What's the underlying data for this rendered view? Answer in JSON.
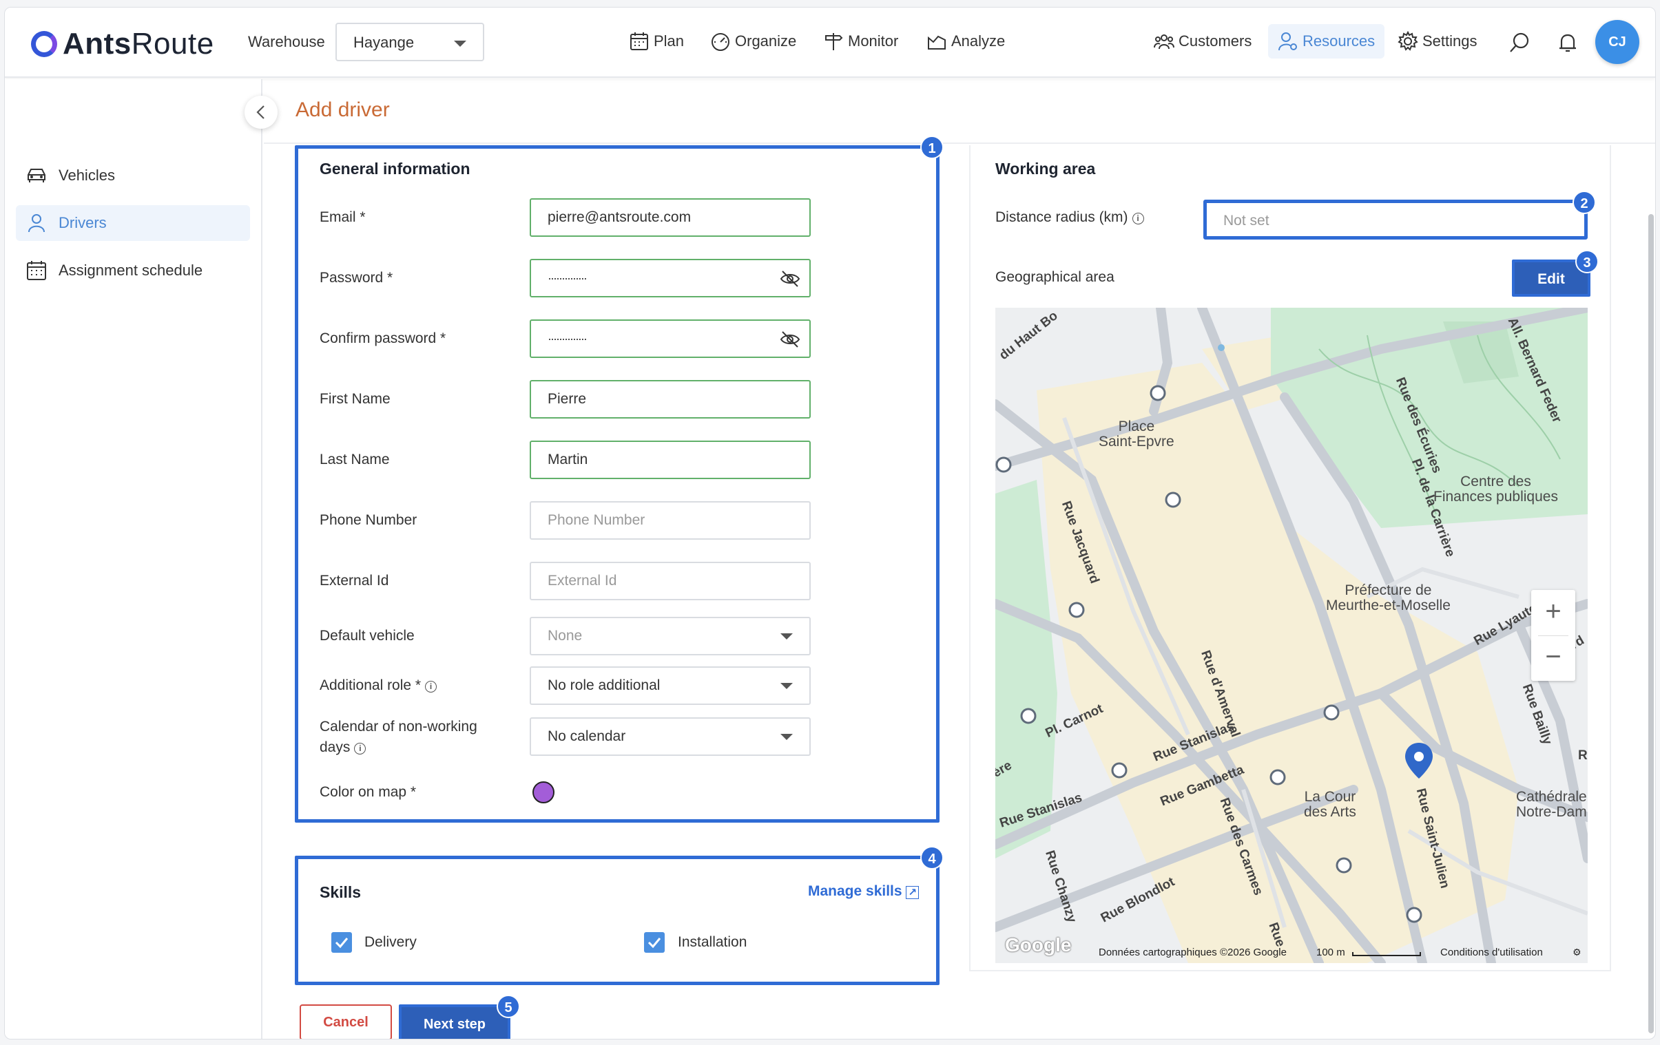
{
  "app": {
    "brand_bold": "Ants",
    "brand_rest": "Route",
    "warehouse_label": "Warehouse",
    "warehouse_value": "Hayange",
    "user_initials": "CJ"
  },
  "nav": {
    "plan": "Plan",
    "organize": "Organize",
    "monitor": "Monitor",
    "analyze": "Analyze",
    "customers": "Customers",
    "resources": "Resources",
    "settings": "Settings"
  },
  "sidebar": {
    "items": [
      {
        "label": "Vehicles"
      },
      {
        "label": "Drivers"
      },
      {
        "label": "Assignment schedule"
      }
    ]
  },
  "page": {
    "title": "Add driver"
  },
  "general": {
    "title": "General information",
    "email_label": "Email *",
    "email_value": "pierre@antsroute.com",
    "password_label": "Password *",
    "password_value": "··············",
    "confirm_label": "Confirm password *",
    "confirm_value": "··············",
    "first_label": "First Name",
    "first_value": "Pierre",
    "last_label": "Last Name",
    "last_value": "Martin",
    "phone_label": "Phone Number",
    "phone_placeholder": "Phone Number",
    "external_label": "External Id",
    "external_placeholder": "External Id",
    "vehicle_label": "Default vehicle",
    "vehicle_value": "None",
    "role_label": "Additional role *",
    "role_value": "No role additional",
    "calendar_label_1": "Calendar of non-working",
    "calendar_label_2": "days",
    "calendar_value": "No calendar",
    "color_label": "Color on map *",
    "color_value": "#a35dd8"
  },
  "skills": {
    "title": "Skills",
    "manage": "Manage skills",
    "items": [
      {
        "label": "Delivery",
        "checked": true
      },
      {
        "label": "Installation",
        "checked": true
      }
    ]
  },
  "working": {
    "title": "Working area",
    "radius_label": "Distance radius (km)",
    "radius_placeholder": "Not set",
    "geo_label": "Geographical area",
    "edit": "Edit"
  },
  "map": {
    "places": {
      "place_st_epvre": [
        "Place",
        "Saint-Epvre"
      ],
      "centre_finances": [
        "Centre des",
        "Finances publiques"
      ],
      "prefecture": [
        "Préfecture de",
        "Meurthe-et-Moselle"
      ],
      "la_cour": [
        "La Cour",
        "des Arts"
      ],
      "cathedrale": [
        "Cathédrale",
        "Notre-Dam"
      ]
    },
    "streets": {
      "haut_bo": "du Haut Bo",
      "bernard": "All. Bernard Feder",
      "ecuries": "Rue des Écuries",
      "carriere": "Pl. de la Carrière",
      "jacquard": "Rue Jacquard",
      "amerval": "Rue d'Amerval",
      "lyautey": "Rue Lyaute",
      "carnot": "Pl. Carnot",
      "stanislas1": "Rue Stanislas",
      "gambetta": "Rue Gambetta",
      "stanislas2": "Rue Stanislas",
      "carmes": "Rue des Carmes",
      "bailly": "Rue Bailly",
      "st_julien": "Rue Saint-Julien",
      "chanzy": "Rue Chanzy",
      "blondlot": "Rue Blondlot",
      "rue_short": "Rue",
      "ere": "ère",
      "rd": "rd",
      "r": "R"
    },
    "footer": {
      "google": "Google",
      "data": "Données cartographiques ©2026 Google",
      "scale": "100 m",
      "terms": "Conditions d'utilisation"
    }
  },
  "actions": {
    "cancel": "Cancel",
    "next": "Next step"
  },
  "badges": [
    "1",
    "2",
    "3",
    "4",
    "5"
  ]
}
